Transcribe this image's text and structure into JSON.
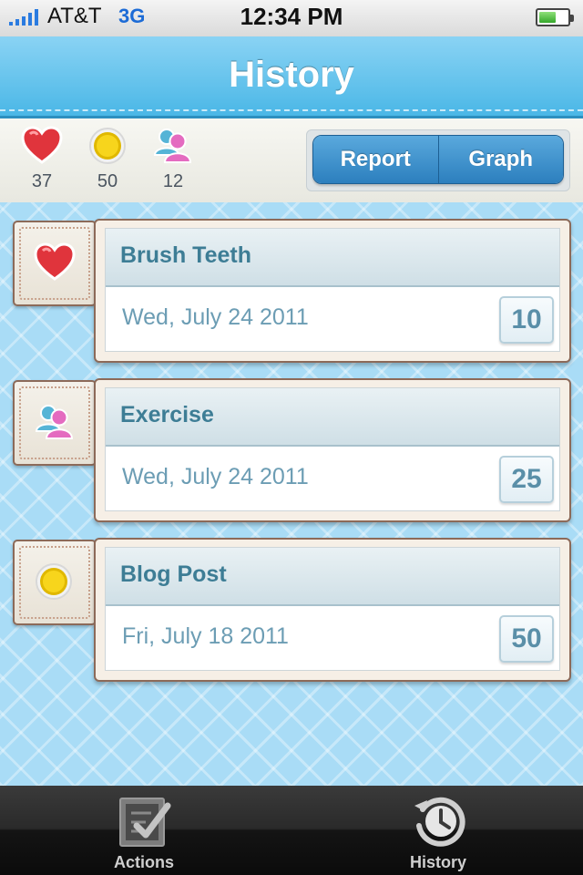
{
  "status_bar": {
    "carrier": "AT&T",
    "network": "3G",
    "time": "12:34 PM",
    "battery_level": 0.6
  },
  "nav": {
    "title": "History"
  },
  "stats": [
    {
      "icon": "heart-icon",
      "value": "37"
    },
    {
      "icon": "coin-icon",
      "value": "50"
    },
    {
      "icon": "people-icon",
      "value": "12"
    }
  ],
  "segmented": {
    "report_label": "Report",
    "graph_label": "Graph"
  },
  "entries": [
    {
      "icon": "heart-icon",
      "title": "Brush Teeth",
      "date": "Wed, July 24 2011",
      "points": "10"
    },
    {
      "icon": "people-icon",
      "title": "Exercise",
      "date": "Wed, July 24 2011",
      "points": "25"
    },
    {
      "icon": "coin-icon",
      "title": "Blog Post",
      "date": "Fri, July 18 2011",
      "points": "50"
    }
  ],
  "tab_bar": {
    "actions_label": "Actions",
    "history_label": "History",
    "selected": "History"
  },
  "colors": {
    "nav_blue": "#48b6e6",
    "button_blue": "#2c7fbe",
    "title_teal": "#3d7d95"
  }
}
